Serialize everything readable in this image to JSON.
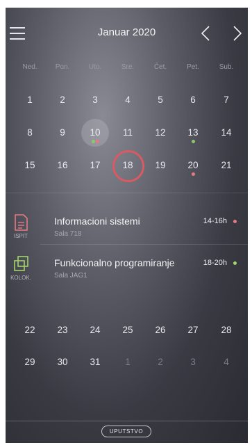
{
  "header": {
    "month_title": "Januar 2020"
  },
  "weekdays": [
    "Ned.",
    "Pon.",
    "Uto.",
    "Sre.",
    "Čet.",
    "Pet.",
    "Sub."
  ],
  "weeks_top": [
    [
      {
        "n": "1"
      },
      {
        "n": "2"
      },
      {
        "n": "3"
      },
      {
        "n": "4"
      },
      {
        "n": "5"
      },
      {
        "n": "6"
      },
      {
        "n": "7"
      }
    ],
    [
      {
        "n": "8"
      },
      {
        "n": "9"
      },
      {
        "n": "10",
        "today": true,
        "dots": [
          "#8ec86a",
          "#e57a82"
        ]
      },
      {
        "n": "11"
      },
      {
        "n": "12"
      },
      {
        "n": "13",
        "dots": [
          "#8ec86a"
        ]
      },
      {
        "n": "14"
      }
    ],
    [
      {
        "n": "15"
      },
      {
        "n": "16"
      },
      {
        "n": "17"
      },
      {
        "n": "18",
        "selected": true
      },
      {
        "n": "19"
      },
      {
        "n": "20",
        "dots": [
          "#e57a82"
        ]
      },
      {
        "n": "21"
      }
    ]
  ],
  "events": [
    {
      "type": "ISPIT",
      "title": "Informacioni sistemi",
      "room": "Sala 718",
      "time": "14-16h",
      "color": "#e57a82",
      "icon": "document-icon"
    },
    {
      "type": "KOLOK.",
      "title": "Funkcionalno programiranje",
      "room": "Sala JAG1",
      "time": "18-20h",
      "color": "#a4d46b",
      "icon": "stacked-squares-icon"
    }
  ],
  "weeks_bottom": [
    [
      {
        "n": "22"
      },
      {
        "n": "23"
      },
      {
        "n": "24"
      },
      {
        "n": "25"
      },
      {
        "n": "26"
      },
      {
        "n": "27"
      },
      {
        "n": "28"
      }
    ],
    [
      {
        "n": "29"
      },
      {
        "n": "30"
      },
      {
        "n": "31"
      },
      {
        "n": "1",
        "muted": true
      },
      {
        "n": "2",
        "muted": true
      },
      {
        "n": "3",
        "muted": true
      },
      {
        "n": "4",
        "muted": true
      }
    ]
  ],
  "footer": {
    "guide_label": "UPUTSTVO"
  },
  "colors": {
    "accent_red": "#d85a62",
    "dot_red": "#e57a82",
    "dot_green": "#8ec86a"
  }
}
